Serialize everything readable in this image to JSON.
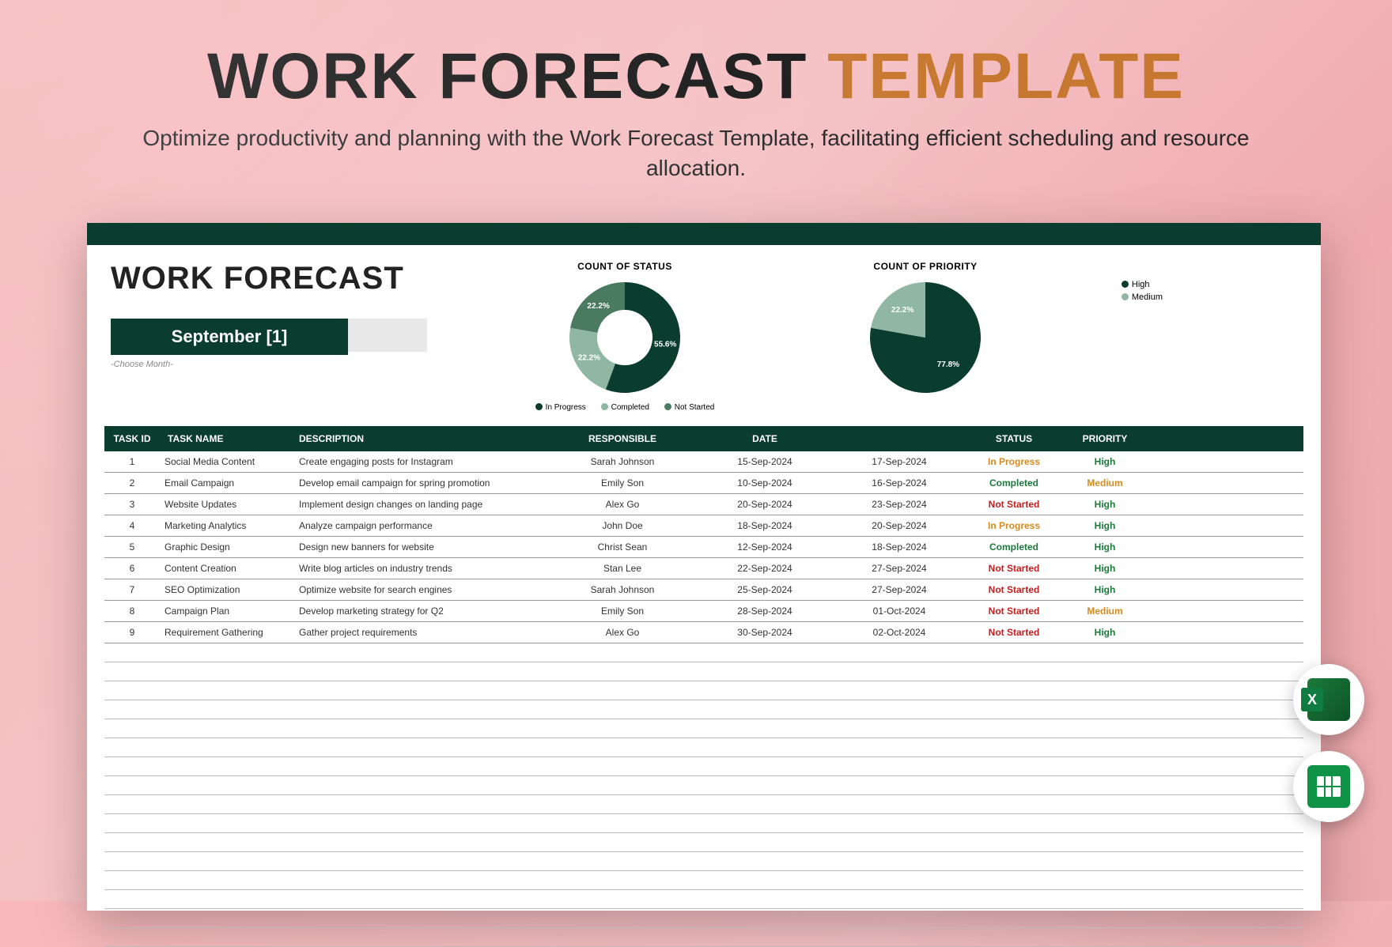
{
  "hero": {
    "title_a": "WORK FORECAST ",
    "title_b": "TEMPLATE",
    "subtitle": "Optimize productivity and planning with the Work Forecast Template, facilitating efficient scheduling and resource allocation."
  },
  "sheet": {
    "title": "WORK FORECAST",
    "month": "September [1]",
    "choose_hint": "-Choose Month-"
  },
  "chart_data": [
    {
      "type": "pie",
      "title": "COUNT OF STATUS",
      "series": [
        {
          "name": "In Progress",
          "value": 55.6,
          "color": "#0a3d2e"
        },
        {
          "name": "Completed",
          "value": 22.2,
          "color": "#8fb7a3"
        },
        {
          "name": "Not Started",
          "value": 22.2,
          "color": "#4a7a5f"
        }
      ],
      "is_donut": true,
      "labels_shown": [
        "22.2%",
        "22.2%",
        "55.6%"
      ]
    },
    {
      "type": "pie",
      "title": "COUNT OF PRIORITY",
      "series": [
        {
          "name": "High",
          "value": 77.8,
          "color": "#0a3d2e"
        },
        {
          "name": "Medium",
          "value": 22.2,
          "color": "#8fb7a3"
        }
      ],
      "is_donut": false,
      "labels_shown": [
        "77.8%",
        "22.2%"
      ]
    }
  ],
  "legend_priority": {
    "high": "High",
    "medium": "Medium"
  },
  "legend_status": {
    "inprog": "In Progress",
    "completed": "Completed",
    "notstarted": "Not Started"
  },
  "table": {
    "headers": {
      "id": "TASK ID",
      "name": "TASK NAME",
      "desc": "DESCRIPTION",
      "resp": "RESPONSIBLE",
      "date": "DATE",
      "status": "STATUS",
      "priority": "PRIORITY"
    },
    "rows": [
      {
        "id": "1",
        "name": "Social Media Content",
        "desc": "Create engaging posts for Instagram",
        "resp": "Sarah Johnson",
        "d1": "15-Sep-2024",
        "d2": "17-Sep-2024",
        "status": "In Progress",
        "priority": "High"
      },
      {
        "id": "2",
        "name": "Email Campaign",
        "desc": "Develop email campaign for spring promotion",
        "resp": "Emily Son",
        "d1": "10-Sep-2024",
        "d2": "16-Sep-2024",
        "status": "Completed",
        "priority": "Medium"
      },
      {
        "id": "3",
        "name": "Website Updates",
        "desc": "Implement design changes on landing page",
        "resp": "Alex Go",
        "d1": "20-Sep-2024",
        "d2": "23-Sep-2024",
        "status": "Not Started",
        "priority": "High"
      },
      {
        "id": "4",
        "name": "Marketing Analytics",
        "desc": "Analyze campaign performance",
        "resp": "John Doe",
        "d1": "18-Sep-2024",
        "d2": "20-Sep-2024",
        "status": "In Progress",
        "priority": "High"
      },
      {
        "id": "5",
        "name": "Graphic Design",
        "desc": "Design new banners for website",
        "resp": "Christ Sean",
        "d1": "12-Sep-2024",
        "d2": "18-Sep-2024",
        "status": "Completed",
        "priority": "High"
      },
      {
        "id": "6",
        "name": "Content Creation",
        "desc": "Write blog articles on industry trends",
        "resp": "Stan Lee",
        "d1": "22-Sep-2024",
        "d2": "27-Sep-2024",
        "status": "Not Started",
        "priority": "High"
      },
      {
        "id": "7",
        "name": "SEO Optimization",
        "desc": "Optimize website for search engines",
        "resp": "Sarah Johnson",
        "d1": "25-Sep-2024",
        "d2": "27-Sep-2024",
        "status": "Not Started",
        "priority": "High"
      },
      {
        "id": "8",
        "name": "Campaign Plan",
        "desc": "Develop marketing strategy for Q2",
        "resp": "Emily Son",
        "d1": "28-Sep-2024",
        "d2": "01-Oct-2024",
        "status": "Not Started",
        "priority": "Medium"
      },
      {
        "id": "9",
        "name": "Requirement Gathering",
        "desc": "Gather project requirements",
        "resp": "Alex Go",
        "d1": "30-Sep-2024",
        "d2": "02-Oct-2024",
        "status": "Not Started",
        "priority": "High"
      }
    ]
  },
  "colors": {
    "dark_green": "#0a3d2e",
    "mid_green": "#4a7a5f",
    "light_green": "#8fb7a3",
    "orange": "#c77830"
  }
}
